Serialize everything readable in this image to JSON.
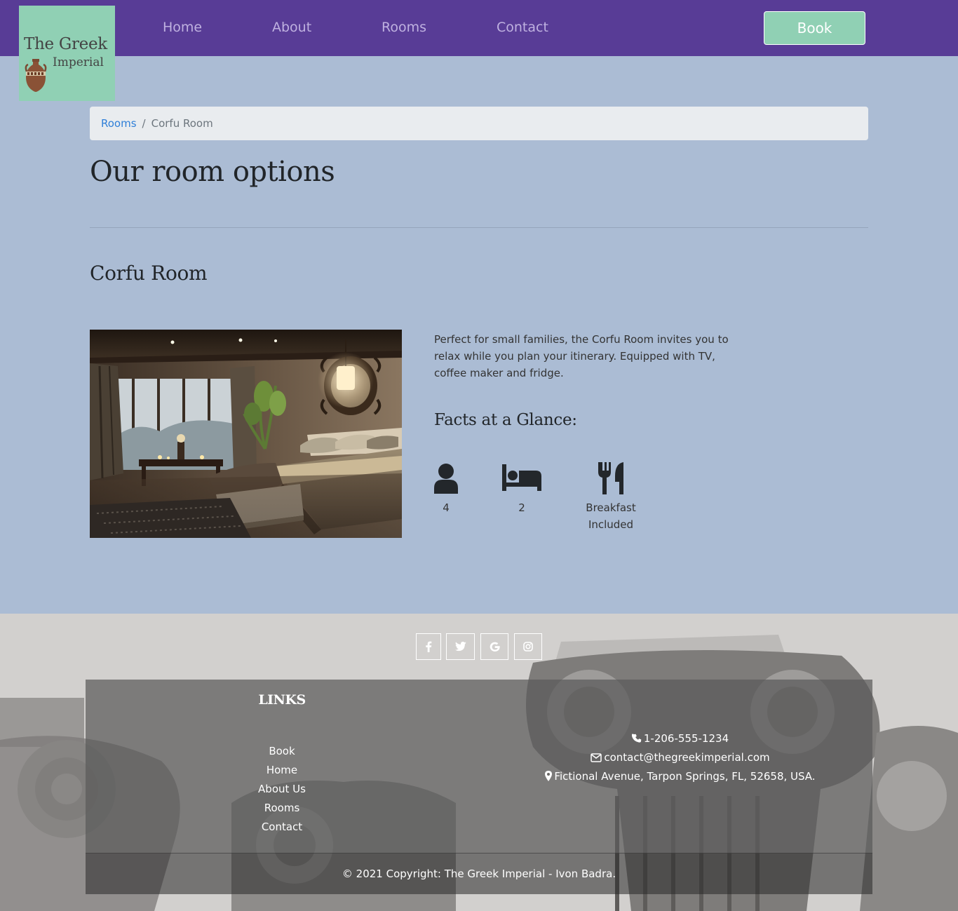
{
  "brand": {
    "logo_line1": "The Greek",
    "logo_line2": "Imperial",
    "logo_color": "#90d0b4",
    "nav_color": "#583c96",
    "page_bg": "#abbcd4"
  },
  "nav": {
    "items": [
      {
        "label": "Home"
      },
      {
        "label": "About"
      },
      {
        "label": "Rooms"
      },
      {
        "label": "Contact"
      }
    ],
    "book_label": "Book"
  },
  "breadcrumb": {
    "parent": "Rooms",
    "separator": "/",
    "current": "Corfu Room"
  },
  "page": {
    "title": "Our room options"
  },
  "room": {
    "name": "Corfu Room",
    "description": "Perfect for small families, the Corfu Room invites you to relax while you plan your itinerary. Equipped with TV, coffee maker and fridge.",
    "facts_title": "Facts at a Glance:",
    "facts": [
      {
        "icon": "user-icon",
        "value": "4"
      },
      {
        "icon": "bed-icon",
        "value": "2"
      },
      {
        "icon": "utensils-icon",
        "value_line1": "Breakfast",
        "value_line2": "Included"
      }
    ]
  },
  "footer": {
    "social": [
      {
        "icon": "facebook-icon"
      },
      {
        "icon": "twitter-icon"
      },
      {
        "icon": "google-icon"
      },
      {
        "icon": "instagram-icon"
      }
    ],
    "links_title": "LINKS",
    "links": [
      {
        "label": "Book"
      },
      {
        "label": "Home"
      },
      {
        "label": "About Us"
      },
      {
        "label": "Rooms"
      },
      {
        "label": "Contact"
      }
    ],
    "contact": {
      "phone": "1-206-555-1234",
      "email": "contact@thegreekimperial.com",
      "address": "Fictional Avenue, Tarpon Springs, FL, 52658, USA."
    },
    "copyright": "© 2021 Copyright: The Greek Imperial - Ivon Badra."
  }
}
